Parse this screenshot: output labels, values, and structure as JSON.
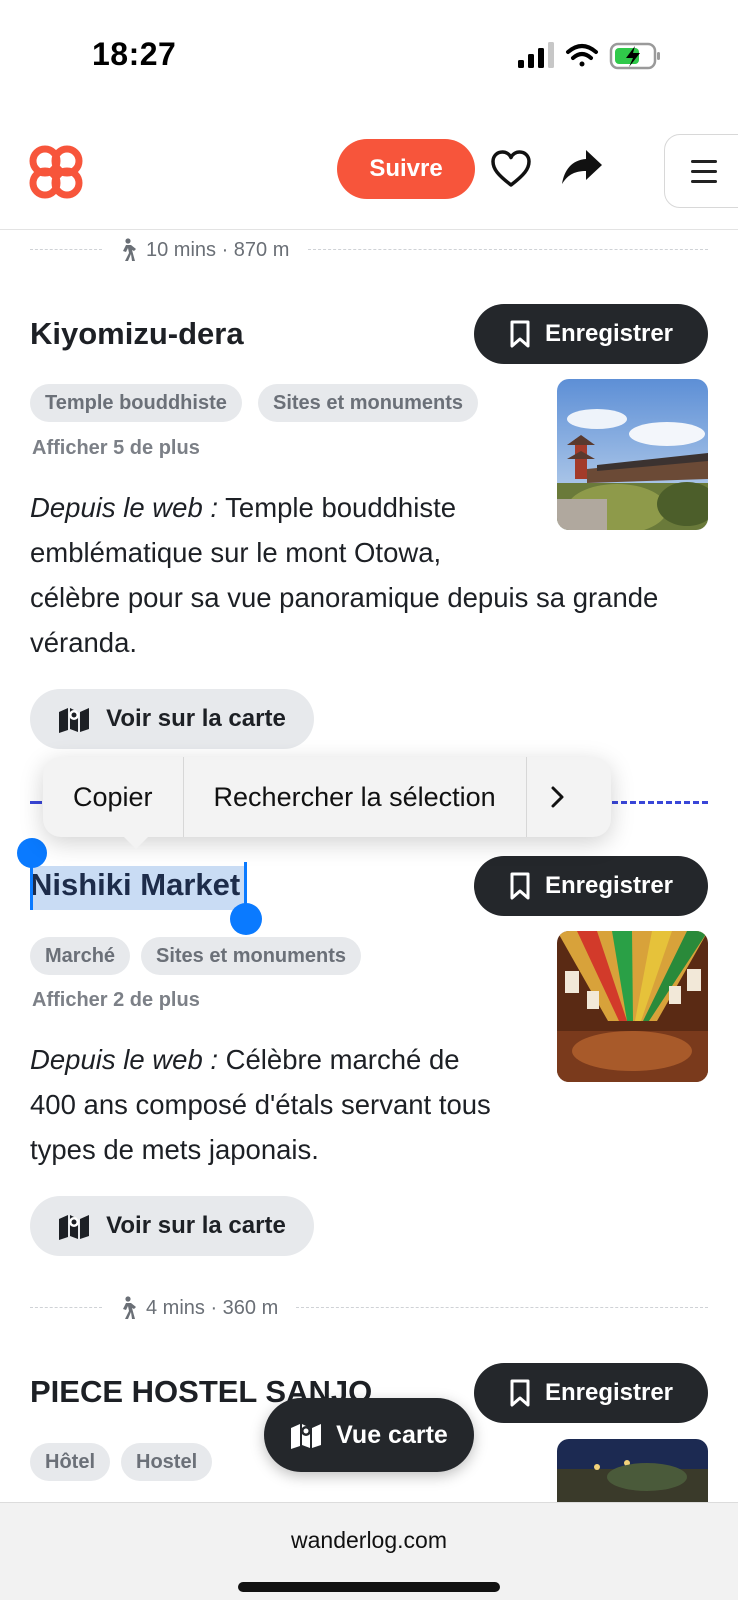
{
  "status": {
    "time": "18:27"
  },
  "header": {
    "follow_label": "Suivre",
    "accent_color": "#f7553b",
    "icons": [
      "app-logo-icon",
      "heart-icon",
      "share-icon",
      "menu-icon"
    ]
  },
  "walk_top": {
    "label": "10 mins · 870 m"
  },
  "places": [
    {
      "title": "Kiyomizu-dera",
      "save_label": "Enregistrer",
      "tags": [
        "Temple bouddhiste",
        "Sites et monuments"
      ],
      "more": "Afficher 5 de plus",
      "desc_prefix": "Depuis le web :",
      "desc_line1": " Temple bouddhiste",
      "desc_line2": "emblématique sur le mont Otowa,",
      "desc_line3": "célèbre pour sa vue panoramique depuis sa grande",
      "desc_line4": "véranda.",
      "map_label": "Voir sur la carte"
    },
    {
      "title": "Nishiki Market",
      "save_label": "Enregistrer",
      "tags": [
        "Marché",
        "Sites et monuments"
      ],
      "more": "Afficher 2 de plus",
      "desc_prefix": "Depuis le web :",
      "desc_line1": " Célèbre marché de",
      "desc_line2": "400 ans composé d'étals servant tous",
      "desc_line3": "types de mets japonais.",
      "map_label": "Voir sur la carte"
    },
    {
      "title": "PIECE HOSTEL SANJO",
      "save_label": "Enregistrer",
      "tags": [
        "Hôtel",
        "Hostel"
      ]
    }
  ],
  "walk_mid": {
    "label": "4 mins · 360 m"
  },
  "context_menu": {
    "copy": "Copier",
    "lookup": "Rechercher la sélection",
    "next_icon": "chevron-right-icon"
  },
  "fab": {
    "label": "Vue carte"
  },
  "browser": {
    "url": "wanderlog.com"
  }
}
